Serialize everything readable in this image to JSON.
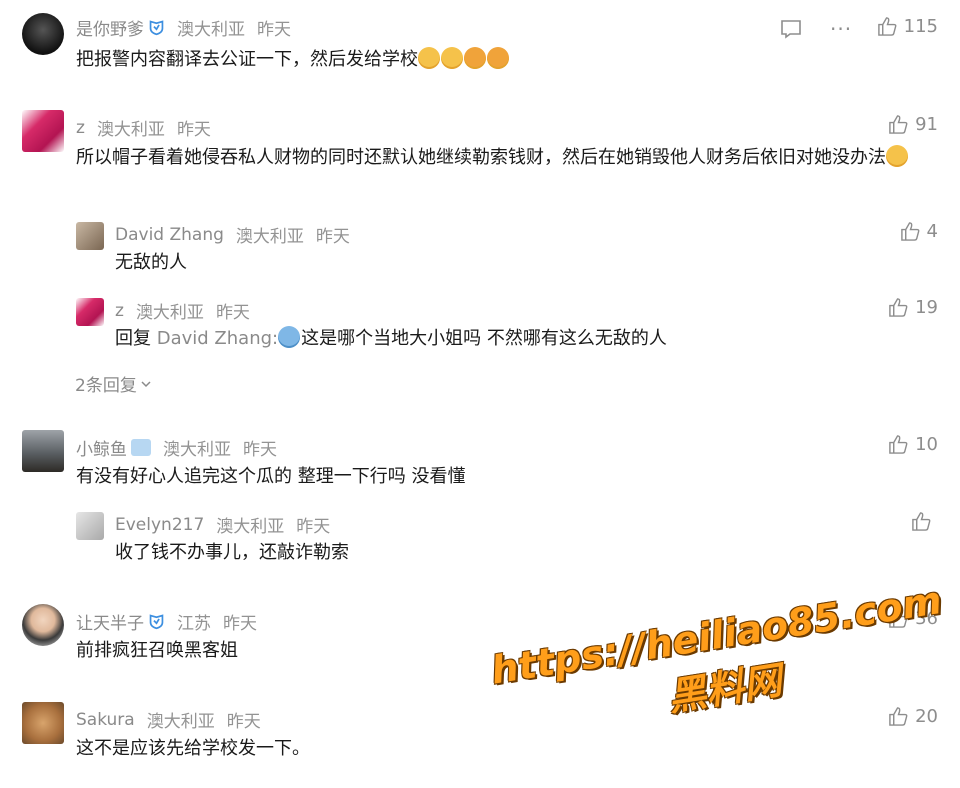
{
  "comments": [
    {
      "user": "是你野爹",
      "location": "澳大利亚",
      "time": "昨天",
      "text": "把报警内容翻译去公证一下，然后发给学校",
      "likes": "115",
      "verified": true
    },
    {
      "user": "z",
      "location": "澳大利亚",
      "time": "昨天",
      "text": "所以帽子看着她侵吞私人财物的同时还默认她继续勒索钱财，然后在她销毁他人财务后依旧对她没办法",
      "likes": "91"
    },
    {
      "user": "David Zhang",
      "location": "澳大利亚",
      "time": "昨天",
      "text": "无敌的人",
      "likes": "4"
    },
    {
      "user": "z",
      "location": "澳大利亚",
      "time": "昨天",
      "reply_prefix": "回复",
      "reply_to": "David Zhang",
      "reply_colon": ":",
      "text": "这是哪个当地大小姐吗 不然哪有这么无敌的人",
      "likes": "19"
    },
    {
      "user": "小鲸鱼",
      "location": "澳大利亚",
      "time": "昨天",
      "text": "有没有好心人追完这个瓜的 整理一下行吗 没看懂",
      "likes": "10"
    },
    {
      "user": "Evelyn217",
      "location": "澳大利亚",
      "time": "昨天",
      "text": "收了钱不办事儿，还敲诈勒索",
      "likes": ""
    },
    {
      "user": "让天半子",
      "location": "江苏",
      "time": "昨天",
      "text": "前排疯狂召唤黑客姐",
      "likes": "36",
      "verified": true
    },
    {
      "user": "Sakura",
      "location": "澳大利亚",
      "time": "昨天",
      "text": "这不是应该先给学校发一下。",
      "likes": "20"
    }
  ],
  "more_replies": "2条回复",
  "watermark": {
    "url": "https://heiliao85.com",
    "name": "黑料网"
  },
  "colors": {
    "meta": "#939393",
    "text": "#1a1a1a",
    "verified": "#3d8fe0",
    "watermark": "#ff9e1a"
  }
}
